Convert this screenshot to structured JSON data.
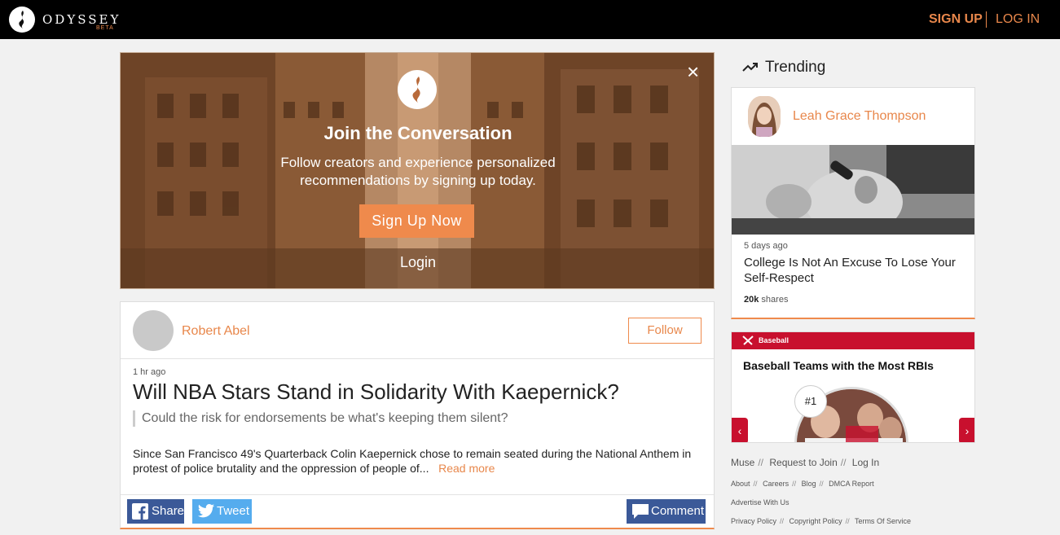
{
  "header": {
    "logo_text": "ODYSSEY",
    "logo_beta": "BETA",
    "signup_label": "SIGN UP",
    "login_label": "LOG IN"
  },
  "join_banner": {
    "title": "Join the Conversation",
    "subtitle": "Follow creators and experience personalized recommendations by signing up today.",
    "signup_button": "Sign Up Now",
    "login_link": "Login",
    "close_label": "×"
  },
  "article": {
    "author": "Robert Abel",
    "follow_label": "Follow",
    "time": "1 hr ago",
    "headline": "Will NBA Stars Stand in Solidarity With Kaepernick?",
    "subhead": "Could the risk for endorsements be what's keeping them silent?",
    "excerpt": "Since San Francisco 49's Quarterback Colin Kaepernick chose to remain seated during the National Anthem in protest of police brutality and the oppression of people of...",
    "read_more": "Read more",
    "share_label": "Share",
    "tweet_label": "Tweet",
    "comment_label": "Comment"
  },
  "trending": {
    "heading": "Trending",
    "author": "Leah Grace Thompson",
    "time": "5 days ago",
    "title": "College Is Not An Excuse To Lose Your Self-Respect",
    "shares_count": "20k",
    "shares_label": "shares"
  },
  "ranker": {
    "category": "Baseball",
    "title": "Baseball Teams with the Most RBIs",
    "rank": "#1",
    "accent_color": "#c8102e"
  },
  "footer": {
    "main_links": [
      "Muse",
      "Request to Join",
      "Log In"
    ],
    "links_row1": [
      "About",
      "Careers",
      "Blog",
      "DMCA Report"
    ],
    "links_row2": [
      "Advertise With Us"
    ],
    "links_row3": [
      "Privacy Policy",
      "Copyright Policy",
      "Terms Of Service"
    ],
    "separator": "//"
  },
  "colors": {
    "brand_orange": "#e8874b",
    "header_bg": "#000000",
    "facebook": "#3b5998",
    "twitter": "#55acee"
  }
}
